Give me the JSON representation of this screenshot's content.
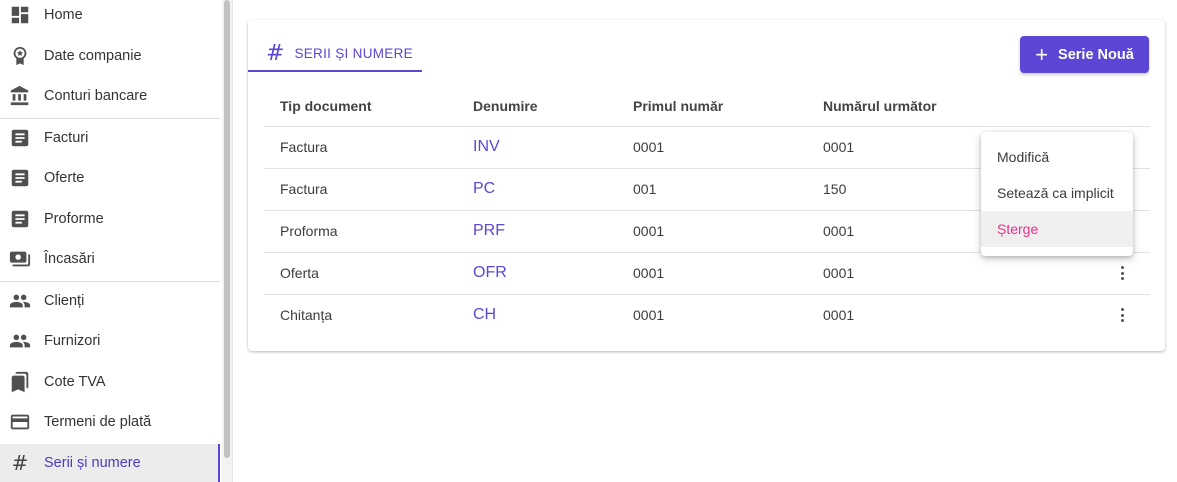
{
  "sidebar": {
    "items": [
      {
        "label": "Home",
        "icon": "dashboard-icon"
      },
      {
        "label": "Date companie",
        "icon": "award-icon"
      },
      {
        "label": "Conturi bancare",
        "icon": "bank-icon"
      },
      {
        "label": "Facturi",
        "icon": "document-icon"
      },
      {
        "label": "Oferte",
        "icon": "document-icon"
      },
      {
        "label": "Proforme",
        "icon": "document-icon"
      },
      {
        "label": "Încasări",
        "icon": "money-icon"
      },
      {
        "label": "Clienți",
        "icon": "people-icon"
      },
      {
        "label": "Furnizori",
        "icon": "people-icon"
      },
      {
        "label": "Cote TVA",
        "icon": "bookmark-icon"
      },
      {
        "label": "Termeni de plată",
        "icon": "credit-card-icon"
      },
      {
        "label": "Serii și numere",
        "icon": "hash-icon"
      }
    ],
    "active": "Serii și numere"
  },
  "card": {
    "tab_label": "SERII ȘI NUMERE",
    "tab_icon": "#",
    "new_button_label": "Serie Nouă",
    "new_button_icon": "+"
  },
  "table": {
    "headers": [
      "Tip document",
      "Denumire",
      "Primul număr",
      "Numărul următor"
    ],
    "rows": [
      {
        "tip": "Factura",
        "denumire": "INV",
        "primul": "0001",
        "urmator": "0001"
      },
      {
        "tip": "Factura",
        "denumire": "PC",
        "primul": "001",
        "urmator": "150"
      },
      {
        "tip": "Proforma",
        "denumire": "PRF",
        "primul": "0001",
        "urmator": "0001"
      },
      {
        "tip": "Oferta",
        "denumire": "OFR",
        "primul": "0001",
        "urmator": "0001"
      },
      {
        "tip": "Chitanța",
        "denumire": "CH",
        "primul": "0001",
        "urmator": "0001"
      }
    ]
  },
  "context_menu": {
    "items": [
      "Modifică",
      "Setează ca implicit",
      "Șterge"
    ]
  },
  "colors": {
    "accent": "#5b46d6",
    "danger": "#e6318a"
  }
}
